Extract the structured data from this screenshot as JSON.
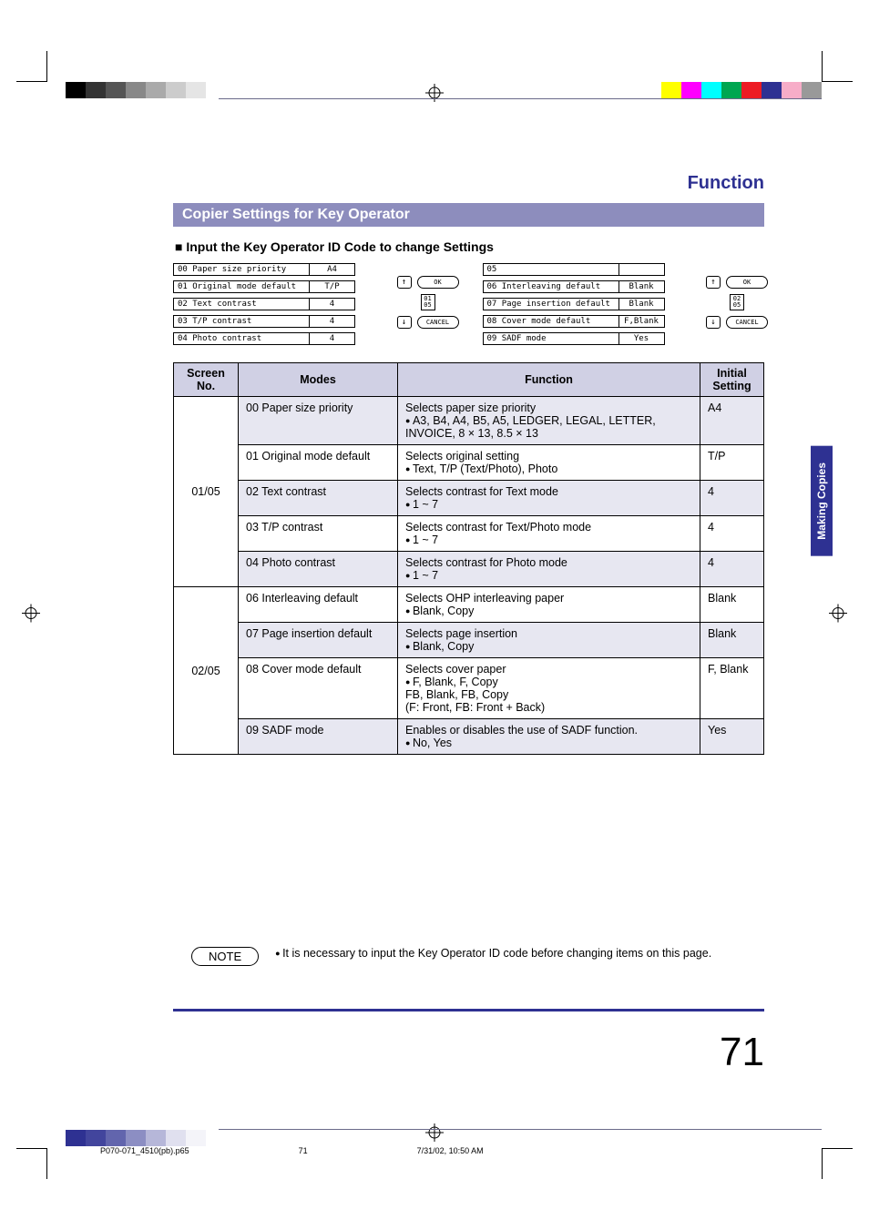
{
  "header": {
    "function_label": "Function"
  },
  "section_title": "Copier Settings for Key Operator",
  "sub_heading": "Input the Key Operator ID Code to change Settings",
  "side_tab": "Making Copies",
  "mini_screens": {
    "left": {
      "rows": [
        {
          "label": "00  Paper size priority",
          "value": "A4"
        },
        {
          "label": "01  Original mode default",
          "value": "T/P"
        },
        {
          "label": "02  Text contrast",
          "value": "4"
        },
        {
          "label": "03  T/P contrast",
          "value": "4"
        },
        {
          "label": "04  Photo contrast",
          "value": "4"
        }
      ],
      "page_frac_top": "01",
      "page_frac_bot": "05",
      "ok": "OK",
      "cancel": "CANCEL"
    },
    "right": {
      "rows": [
        {
          "label": "05",
          "value": ""
        },
        {
          "label": "06  Interleaving default",
          "value": "Blank"
        },
        {
          "label": "07  Page insertion default",
          "value": "Blank"
        },
        {
          "label": "08  Cover mode default",
          "value": "F,Blank"
        },
        {
          "label": "09  SADF mode",
          "value": "Yes"
        }
      ],
      "page_frac_top": "02",
      "page_frac_bot": "05",
      "ok": "OK",
      "cancel": "CANCEL"
    }
  },
  "table": {
    "headers": {
      "screen": "Screen No.",
      "modes": "Modes",
      "function": "Function",
      "initial": "Initial Setting"
    },
    "group1": {
      "screen_no": "01/05",
      "rows": [
        {
          "mode": "00 Paper size priority",
          "func_line": "Selects paper size priority",
          "func_bullet": "A3, B4, A4, B5, A5, LEDGER, LEGAL, LETTER, INVOICE, 8 × 13, 8.5 × 13",
          "initial": "A4",
          "alt": true
        },
        {
          "mode": "01 Original mode default",
          "func_line": "Selects original setting",
          "func_bullet": "Text, T/P (Text/Photo), Photo",
          "initial": "T/P",
          "alt": false
        },
        {
          "mode": "02 Text contrast",
          "func_line": "Selects contrast for Text mode",
          "func_bullet": "1 ~ 7",
          "initial": "4",
          "alt": true
        },
        {
          "mode": "03 T/P contrast",
          "func_line": "Selects contrast for Text/Photo mode",
          "func_bullet": "1 ~ 7",
          "initial": "4",
          "alt": false
        },
        {
          "mode": "04 Photo contrast",
          "func_line": "Selects contrast for Photo mode",
          "func_bullet": "1 ~ 7",
          "initial": "4",
          "alt": true
        }
      ]
    },
    "group2": {
      "screen_no": "02/05",
      "rows": [
        {
          "mode": "06 Interleaving default",
          "func_line": "Selects OHP interleaving paper",
          "func_bullet": "Blank, Copy",
          "initial": "Blank",
          "alt": false
        },
        {
          "mode": "07 Page insertion default",
          "func_line": "Selects page insertion",
          "func_bullet": "Blank, Copy",
          "initial": "Blank",
          "alt": true
        },
        {
          "mode": "08 Cover mode default",
          "func_line": "Selects cover paper",
          "func_bullet": "F, Blank, F, Copy\nFB, Blank, FB, Copy\n(F: Front, FB: Front + Back)",
          "initial": "F, Blank",
          "alt": false
        },
        {
          "mode": "09 SADF mode",
          "func_line": "Enables or disables the use of SADF function.",
          "func_bullet": "No, Yes",
          "initial": "Yes",
          "alt": true
        }
      ]
    }
  },
  "note": {
    "label": "NOTE",
    "text": "It is necessary to input the Key Operator ID code before changing items on this page."
  },
  "page_number": "71",
  "footer": {
    "file": "P070-071_4510(pb).p65",
    "page": "71",
    "date": "7/31/02, 10:50 AM"
  }
}
